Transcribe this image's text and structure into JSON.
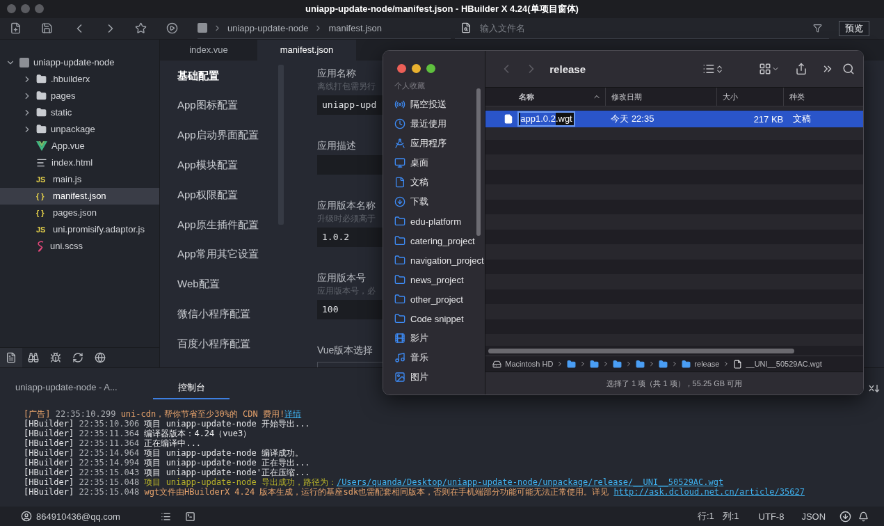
{
  "window": {
    "title": "uniapp-update-node/manifest.json - HBuilder X 4.24(单项目窗体)"
  },
  "toolbar": {
    "breadcrumb": [
      "uniapp-update-node",
      "manifest.json"
    ],
    "search": {
      "placeholder": "输入文件名"
    },
    "preview_button": "预览"
  },
  "project_tree": {
    "name": "uniapp-update-node",
    "expanded": true,
    "children": [
      {
        "name": ".hbuilderx",
        "kind": "folder",
        "expanded": false,
        "selected": false
      },
      {
        "name": "pages",
        "kind": "folder",
        "expanded": false,
        "selected": false
      },
      {
        "name": "static",
        "kind": "folder",
        "expanded": false,
        "selected": false
      },
      {
        "name": "unpackage",
        "kind": "folder",
        "expanded": false,
        "selected": false
      },
      {
        "name": "App.vue",
        "kind": "vue",
        "selected": false
      },
      {
        "name": "index.html",
        "kind": "html",
        "selected": false
      },
      {
        "name": "main.js",
        "kind": "js",
        "badge": "JS",
        "selected": false
      },
      {
        "name": "manifest.json",
        "kind": "json",
        "badge": "{ }",
        "selected": true
      },
      {
        "name": "pages.json",
        "kind": "json",
        "badge": "{ }",
        "selected": false
      },
      {
        "name": "uni.promisify.adaptor.js",
        "kind": "js",
        "badge": "JS",
        "selected": false
      },
      {
        "name": "uni.scss",
        "kind": "scss",
        "selected": false
      }
    ]
  },
  "editor_tabs": [
    {
      "label": "index.vue",
      "selected": false
    },
    {
      "label": "manifest.json",
      "selected": true
    }
  ],
  "config_nav": [
    {
      "label": "基础配置",
      "selected": true
    },
    {
      "label": "App图标配置",
      "selected": false
    },
    {
      "label": "App启动界面配置",
      "selected": false
    },
    {
      "label": "App模块配置",
      "selected": false
    },
    {
      "label": "App权限配置",
      "selected": false
    },
    {
      "label": "App原生插件配置",
      "selected": false
    },
    {
      "label": "App常用其它设置",
      "selected": false
    },
    {
      "label": "Web配置",
      "selected": false
    },
    {
      "label": "微信小程序配置",
      "selected": false
    },
    {
      "label": "百度小程序配置",
      "selected": false
    }
  ],
  "form": [
    {
      "label": "应用名称",
      "hint": "离线打包需另行",
      "value": "uniapp-upd",
      "kind": "text"
    },
    {
      "label": "应用描述",
      "kind": "text"
    },
    {
      "label": "应用版本名称",
      "hint": "升级时必须高于",
      "value": "1.0.2",
      "kind": "text"
    },
    {
      "label": "应用版本号",
      "hint": "应用版本号，必",
      "value": "100",
      "kind": "text"
    },
    {
      "label": "Vue版本选择",
      "kind": "select"
    }
  ],
  "console_tabs": [
    {
      "label": "uniapp-update-node - A...",
      "selected": false
    },
    {
      "label": "控制台",
      "selected": true
    }
  ],
  "console_lines": [
    {
      "source": "[广告]",
      "time": "22:35:10.299",
      "message": "uni-cdn，帮你节省至少30%的 CDN 费用!",
      "link": "详情",
      "kind": "ad"
    },
    {
      "source": "[HBuilder]",
      "time": "22:35:10.306",
      "message": "项目 uniapp-update-node 开始导出...",
      "kind": "info"
    },
    {
      "source": "[HBuilder]",
      "time": "22:35:11.364",
      "message": "编译器版本：4.24（vue3）",
      "kind": "info"
    },
    {
      "source": "[HBuilder]",
      "time": "22:35:11.364",
      "message": "正在编译中...",
      "kind": "info"
    },
    {
      "source": "[HBuilder]",
      "time": "22:35:14.964",
      "message": "项目 uniapp-update-node 编译成功。",
      "kind": "info"
    },
    {
      "source": "[HBuilder]",
      "time": "22:35:14.994",
      "message": "项目 uniapp-update-node 正在导出...",
      "kind": "info"
    },
    {
      "source": "[HBuilder]",
      "time": "22:35:15.043",
      "message": "项目 uniapp-update-node'正在压缩...",
      "kind": "info"
    },
    {
      "source": "[HBuilder]",
      "time": "22:35:15.048",
      "message": "项目 uniapp-update-node 导出成功，路径为：",
      "link": "/Users/quanda/Desktop/uniapp-update-node/unpackage/release/__UNI__50529AC.wgt",
      "kind": "success"
    },
    {
      "source": "[HBuilder]",
      "time": "22:35:15.048",
      "message": "wgt文件由HBuilderX 4.24 版本生成，运行的基座sdk也需配套相同版本，否则在手机端部分功能可能无法正常使用。详见",
      "link": "http://ask.dcloud.net.cn/article/35627",
      "kind": "warning"
    }
  ],
  "status_bar": {
    "account": "864910436@qq.com",
    "line": "行:1",
    "column": "列:1",
    "encoding": "UTF-8",
    "language": "JSON"
  },
  "finder": {
    "title": "release",
    "sidebar_heading": "个人收藏",
    "sidebar": [
      {
        "label": "隔空投送",
        "kind": "airdrop"
      },
      {
        "label": "最近使用",
        "kind": "recent"
      },
      {
        "label": "应用程序",
        "kind": "apps"
      },
      {
        "label": "桌面",
        "kind": "desktop"
      },
      {
        "label": "文稿",
        "kind": "document"
      },
      {
        "label": "下载",
        "kind": "download"
      },
      {
        "label": "edu-platform",
        "kind": "folder"
      },
      {
        "label": "catering_project",
        "kind": "folder"
      },
      {
        "label": "navigation_project",
        "kind": "folder"
      },
      {
        "label": "news_project",
        "kind": "folder"
      },
      {
        "label": "other_project",
        "kind": "folder"
      },
      {
        "label": "Code snippet",
        "kind": "folder"
      },
      {
        "label": "影片",
        "kind": "movies"
      },
      {
        "label": "音乐",
        "kind": "music"
      },
      {
        "label": "图片",
        "kind": "pictures"
      }
    ],
    "columns": [
      "名称",
      "修改日期",
      "大小",
      "种类"
    ],
    "files": [
      {
        "name_selected": "app1.0.2",
        "name_rest": ".wgt",
        "editing": true,
        "date": "今天 22:35",
        "size": "217 KB",
        "type": "文稿",
        "selected": true
      }
    ],
    "path": [
      {
        "kind": "disk",
        "label": "Macintosh HD"
      },
      {
        "kind": "folder"
      },
      {
        "kind": "folder"
      },
      {
        "kind": "folder"
      },
      {
        "kind": "folder"
      },
      {
        "kind": "folder"
      },
      {
        "kind": "folder",
        "label": "release"
      },
      {
        "kind": "file",
        "label": "__UNI__50529AC.wgt"
      }
    ],
    "status": "选择了 1 项（共 1 项），55.25 GB 可用"
  }
}
